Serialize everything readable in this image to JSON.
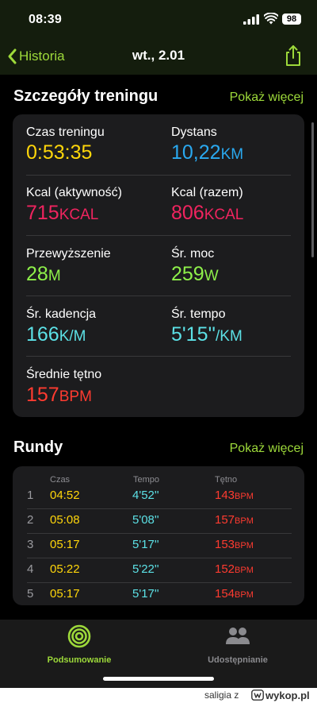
{
  "status": {
    "time": "08:39",
    "battery": "98",
    "icons": [
      "signal-icon",
      "wifi-icon",
      "battery-icon"
    ]
  },
  "nav": {
    "back_label": "Historia",
    "title": "wt., 2.01",
    "back_icon": "chevron-left-icon",
    "share_icon": "share-icon"
  },
  "details": {
    "title": "Szczegóły treningu",
    "more": "Pokaż więcej",
    "stats": [
      {
        "label": "Czas treningu",
        "value": "0:53:35",
        "unit": "",
        "color": "#ffd60a"
      },
      {
        "label": "Dystans",
        "value": "10,22",
        "unit": "km",
        "color": "#2aa9f0"
      },
      {
        "label": "Kcal (aktywność)",
        "value": "715",
        "unit": "kcal",
        "color": "#f0245f"
      },
      {
        "label": "Kcal (razem)",
        "value": "806",
        "unit": "kcal",
        "color": "#f0245f"
      },
      {
        "label": "Przewyższenie",
        "value": "28",
        "unit": "m",
        "color": "#8ef04a"
      },
      {
        "label": "Śr. moc",
        "value": "259",
        "unit": "w",
        "color": "#8ef04a"
      },
      {
        "label": "Śr. kadencja",
        "value": "166",
        "unit": "k/m",
        "color": "#5ce1e6"
      },
      {
        "label": "Śr. tempo",
        "value": "5'15''",
        "unit": "/km",
        "color": "#5ce1e6"
      },
      {
        "label": "Średnie tętno",
        "value": "157",
        "unit": "bpm",
        "color": "#ff3b30"
      }
    ]
  },
  "rounds": {
    "title": "Rundy",
    "more": "Pokaż więcej",
    "headers": {
      "time": "Czas",
      "pace": "Tempo",
      "hr": "Tętno"
    },
    "rows": [
      {
        "n": "1",
        "time": "04:52",
        "pace": "4'52''",
        "hr": "143",
        "unit": "bpm"
      },
      {
        "n": "2",
        "time": "05:08",
        "pace": "5'08''",
        "hr": "157",
        "unit": "bpm"
      },
      {
        "n": "3",
        "time": "05:17",
        "pace": "5'17''",
        "hr": "153",
        "unit": "bpm"
      },
      {
        "n": "4",
        "time": "05:22",
        "pace": "5'22''",
        "hr": "152",
        "unit": "bpm"
      },
      {
        "n": "5",
        "time": "05:17",
        "pace": "5'17''",
        "hr": "154",
        "unit": "bpm"
      }
    ]
  },
  "tabs": [
    {
      "label": "Podsumowanie",
      "icon": "activity-rings-icon",
      "active": true
    },
    {
      "label": "Udostępnianie",
      "icon": "people-icon",
      "active": false
    }
  ],
  "footer": {
    "user": "saligia",
    "separator": "z",
    "brand": "wykop.pl"
  },
  "colors": {
    "accent": "#9dd93a",
    "card": "#1c1c1e",
    "tabbar": "#1a1a1a"
  }
}
